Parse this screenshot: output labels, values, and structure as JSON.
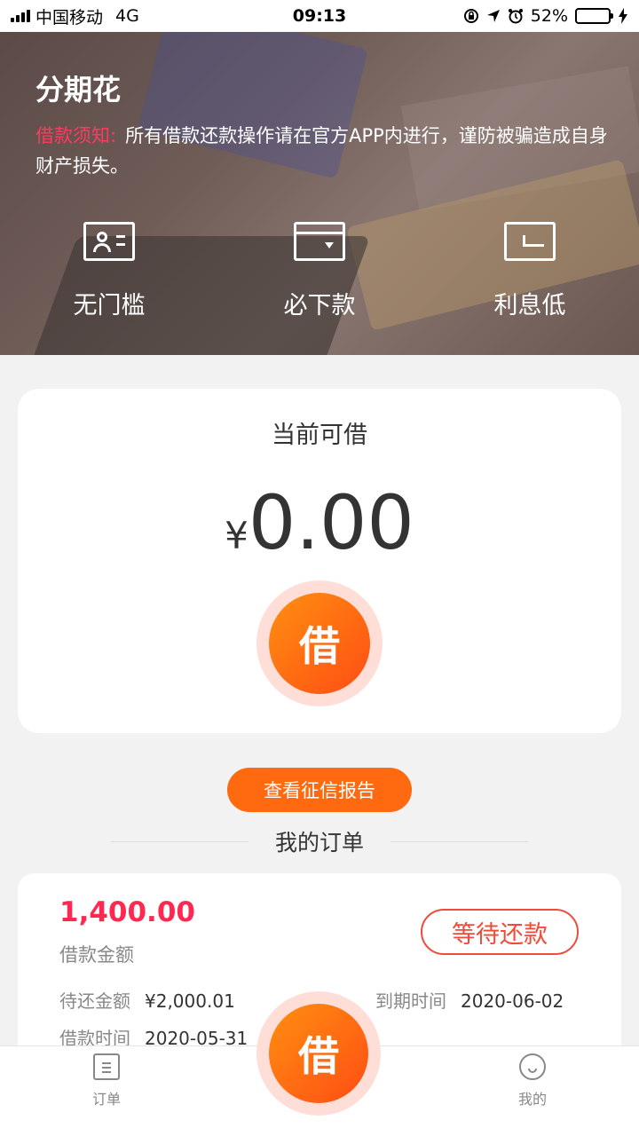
{
  "status_bar": {
    "carrier": "中国移动",
    "network": "4G",
    "time": "09:13",
    "battery": "52%",
    "battery_color": "#4cd964"
  },
  "hero": {
    "title": "分期花",
    "notice_label": "借款须知:",
    "notice_text": "所有借款还款操作请在官方APP内进行，谨防被骗造成自身财产损失。",
    "features": [
      {
        "label": "无门槛",
        "icon": "id-card-icon"
      },
      {
        "label": "必下款",
        "icon": "bank-card-icon"
      },
      {
        "label": "利息低",
        "icon": "return-icon"
      }
    ]
  },
  "borrow_card": {
    "title": "当前可借",
    "currency": "¥",
    "amount": "0.00",
    "button_label": "借"
  },
  "credit_report_button": "查看征信报告",
  "orders": {
    "header": "我的订单",
    "items": [
      {
        "amount": "1,400.00",
        "amount_label": "借款金额",
        "status": "等待还款",
        "repay_label": "待还金额",
        "repay_value": "¥2,000.01",
        "due_label": "到期时间",
        "due_value": "2020-06-02",
        "borrow_time_label": "借款时间",
        "borrow_time_value": "2020-05-31"
      }
    ]
  },
  "tabbar": {
    "orders": "订单",
    "borrow": "借",
    "mine": "我的"
  },
  "colors": {
    "accent": "#ff5a14",
    "amount_red": "#ff2850",
    "status_red": "#f04a3a"
  }
}
